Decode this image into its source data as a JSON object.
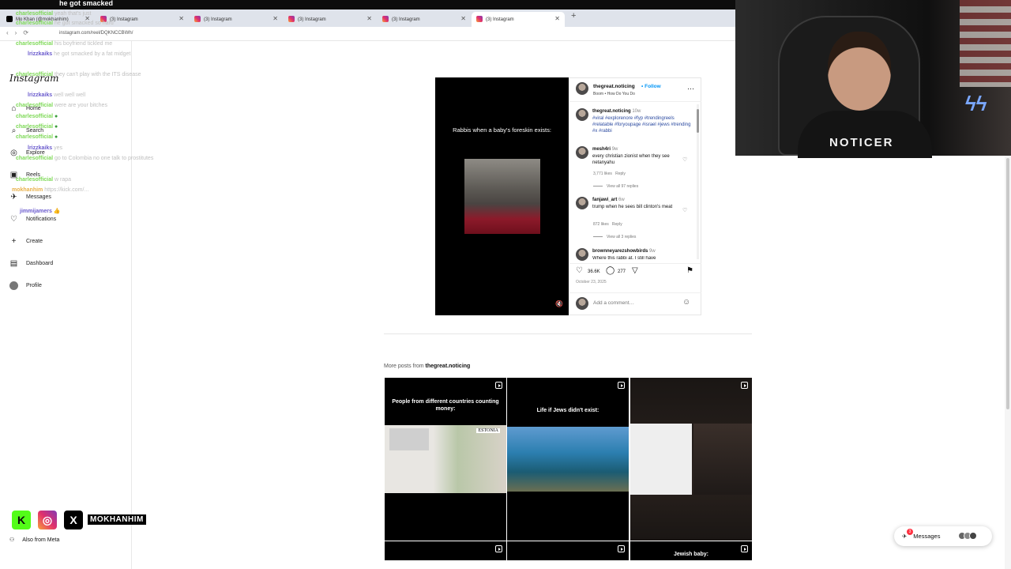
{
  "stream": {
    "headline": "he got smacked",
    "handle": "MOKHANHIM"
  },
  "browser": {
    "tabs": [
      {
        "label": "Mo Khan (@mokhanhim)",
        "icon": "x-logo-icon"
      },
      {
        "label": "(3) Instagram",
        "icon": "instagram-icon"
      },
      {
        "label": "(3) Instagram",
        "icon": "instagram-icon"
      },
      {
        "label": "(3) Instagram",
        "icon": "instagram-icon"
      },
      {
        "label": "(3) Instagram",
        "icon": "instagram-icon"
      },
      {
        "label": "(3) Instagram",
        "icon": "instagram-icon"
      }
    ],
    "new_tab": "+",
    "url": "instagram.com/reel/DQKNCCBWh/"
  },
  "chat": [
    {
      "user": "charlesofficial",
      "msg": "yeah that's just",
      "color": "#7ed957"
    },
    {
      "user": "charlesofficial",
      "msg": "he got smacked so hard",
      "color": "#7ed957"
    },
    {
      "user": "charlesofficial",
      "msg": "his boyfriend tickled me",
      "color": "#7ed957"
    },
    {
      "user": "lrizzkaiks",
      "msg": "he got smacked by a fat midget",
      "color": "#6a5acd"
    },
    {
      "user": "charlesofficial",
      "msg": "they can't play with the ITS disease",
      "color": "#7ed957"
    },
    {
      "user": "lrizzkaiks",
      "msg": "well well well",
      "color": "#6a5acd"
    },
    {
      "user": "charlesofficial",
      "msg": "were are your bitches",
      "color": "#7ed957"
    },
    {
      "user": "charlesofficial",
      "msg": "",
      "color": "#7ed957"
    },
    {
      "user": "charlesofficial",
      "msg": "",
      "color": "#7ed957"
    },
    {
      "user": "charlesofficial",
      "msg": "",
      "color": "#7ed957"
    },
    {
      "user": "lrizzkaiks",
      "msg": "yes",
      "color": "#6a5acd"
    },
    {
      "user": "charlesofficial",
      "msg": "go to Colombia no one talk to prostitutes",
      "color": "#7ed957"
    },
    {
      "user": "charlesofficial",
      "msg": "w rapa",
      "color": "#7ed957"
    },
    {
      "user": "mokhanhim",
      "msg": "https://kick.com/...",
      "color": "#e8b04a"
    },
    {
      "user": "jimmijamers",
      "msg": "👍",
      "color": "#6a5acd"
    }
  ],
  "instagram": {
    "logo": "Instagram",
    "nav": [
      {
        "label": "Home",
        "icon": "home-icon"
      },
      {
        "label": "Search",
        "icon": "search-icon"
      },
      {
        "label": "Explore",
        "icon": "compass-icon"
      },
      {
        "label": "Reels",
        "icon": "reels-icon"
      },
      {
        "label": "Messages",
        "icon": "messenger-icon",
        "badge": "1"
      },
      {
        "label": "Notifications",
        "icon": "heart-icon"
      },
      {
        "label": "Create",
        "icon": "plus-icon"
      },
      {
        "label": "Dashboard",
        "icon": "dashboard-icon"
      },
      {
        "label": "Profile",
        "icon": "avatar"
      }
    ],
    "also_from_meta": "Also from Meta",
    "post": {
      "video_caption": "Rabbis when a baby's foreskin exists:",
      "username": "thegreat.noticing",
      "follow": "Follow",
      "audio": "Boom • How Do You Do",
      "caption_user": "thegreat.noticing",
      "caption_time": "10w",
      "hashtags": "#viral #explorenore #fyp #trendingreels #relatable #foryoupage #israel #jews #trending #x #rabbi",
      "comments": [
        {
          "user": "mesh4ri",
          "time": "9w",
          "text": "every christian zionist when they see netanyahu",
          "likes": "3,771 likes",
          "reply": "Reply",
          "replies": "View all 97 replies"
        },
        {
          "user": "fanjawi_art",
          "time": "6w",
          "text": "trump when he sees bill clinton's meat",
          "likes": "872 likes",
          "reply": "Reply",
          "replies": "View all 3 replies"
        },
        {
          "user": "brownneyarezshowbirds",
          "time": "9w",
          "text": "Where this rabbi at. I still have"
        }
      ],
      "likes": "36.6K",
      "comment_count": "277",
      "date": "October 23, 2025",
      "add_comment": "Add a comment…"
    },
    "more_posts_prefix": "More posts from",
    "more_posts_user": "thegreat.noticing",
    "grid": [
      {
        "caption": "People from different countries counting money:",
        "overlay": "ESTONIA"
      },
      {
        "caption": "Life if Jews didn't exist:"
      },
      {
        "caption": ""
      },
      {
        "caption": ""
      },
      {
        "caption": ""
      },
      {
        "caption": "Jewish baby:"
      }
    ],
    "messages_pill": "Messages",
    "messages_badge": "3"
  },
  "webcam": {
    "shirt_text": "NOTICER"
  },
  "colors": {
    "link_blue": "#0095f6",
    "hashtag_blue": "#2b4aa0",
    "kick_green": "#53fc18",
    "badge_red": "#ff3040"
  }
}
